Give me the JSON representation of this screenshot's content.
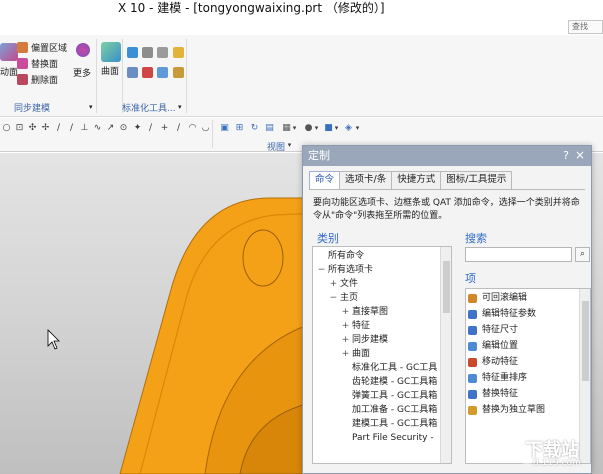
{
  "window": {
    "title": "X 10 - 建模 - [tongyongwaixing.prt （修改的）]",
    "search_stub": "查找"
  },
  "ribbon": {
    "partial_left_label": "动面",
    "sync_group": {
      "items": [
        "偏置区域",
        "替换面",
        "删除面"
      ],
      "more_label": "更多",
      "label": "同步建模"
    },
    "surface_label": "曲面",
    "std_group_label": "标准化工具..."
  },
  "toolbar": {
    "view_label": "视图"
  },
  "dialog": {
    "title": "定制",
    "help": "?",
    "close": "×",
    "tabs": [
      "命令",
      "选项卡/条",
      "快捷方式",
      "图标/工具提示"
    ],
    "active_tab": 0,
    "description": "要向功能区选项卡、边框条或 QAT 添加命令，选择一个类别并将命令从\"命令\"列表拖至所需的位置。",
    "category_label": "类别",
    "search_label": "搜索",
    "items_label": "项",
    "categories": [
      {
        "label": "所有命令",
        "expander": "",
        "indent": 0
      },
      {
        "label": "所有选项卡",
        "expander": "−",
        "indent": 0
      },
      {
        "label": "文件",
        "expander": "+",
        "indent": 1
      },
      {
        "label": "主页",
        "expander": "−",
        "indent": 1
      },
      {
        "label": "直接草图",
        "expander": "+",
        "indent": 2
      },
      {
        "label": "特征",
        "expander": "+",
        "indent": 2
      },
      {
        "label": "同步建模",
        "expander": "+",
        "indent": 2
      },
      {
        "label": "曲面",
        "expander": "+",
        "indent": 2
      },
      {
        "label": "标准化工具 - GC工具",
        "expander": "",
        "indent": 2
      },
      {
        "label": "齿轮建模 - GC工具箱",
        "expander": "",
        "indent": 2
      },
      {
        "label": "弹簧工具 - GC工具箱",
        "expander": "",
        "indent": 2
      },
      {
        "label": "加工准备 - GC工具箱",
        "expander": "",
        "indent": 2
      },
      {
        "label": "建模工具 - GC工具箱",
        "expander": "",
        "indent": 2
      },
      {
        "label": "Part File Security -",
        "expander": "",
        "indent": 2
      }
    ],
    "items": [
      {
        "label": "可回滚编辑",
        "color": "#d4872a"
      },
      {
        "label": "编辑特征参数",
        "color": "#3f74c9"
      },
      {
        "label": "特征尺寸",
        "color": "#3f74c9"
      },
      {
        "label": "编辑位置",
        "color": "#4c8bd6"
      },
      {
        "label": "移动特征",
        "color": "#c9492a"
      },
      {
        "label": "特征重排序",
        "color": "#4c8bd6"
      },
      {
        "label": "替换特征",
        "color": "#3f74c9"
      },
      {
        "label": "替换为独立草图",
        "color": "#d49b2a"
      }
    ]
  },
  "watermark": {
    "text": "下载站",
    "sub": "d.119.com"
  },
  "colors": {
    "part_orange": "#f5a117",
    "dialog_title": "#9aa6ba",
    "accent_blue": "#2f6bc7"
  }
}
